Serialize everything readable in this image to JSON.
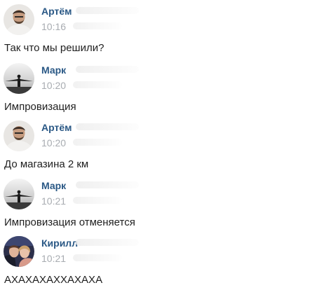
{
  "colors": {
    "author": "#2a5885",
    "time": "#a8acb1",
    "text": "#1f1f1f",
    "background": "#ffffff"
  },
  "messages": [
    {
      "author": "Артём",
      "time": "10:16",
      "text": "Так что мы решили?",
      "avatar_icon": "user-avatar-artem"
    },
    {
      "author": "Марк",
      "time": "10:20",
      "text": "Импровизация",
      "avatar_icon": "user-avatar-mark"
    },
    {
      "author": "Артём",
      "time": "10:20",
      "text": "До магазина 2 км",
      "avatar_icon": "user-avatar-artem"
    },
    {
      "author": "Марк",
      "time": "10:21",
      "text": "Импровизация отменяется",
      "avatar_icon": "user-avatar-mark"
    },
    {
      "author": "Кирилл",
      "time": "10:21",
      "text": "АХАХАХАХХАХАХА",
      "avatar_icon": "user-avatar-kirill"
    }
  ]
}
